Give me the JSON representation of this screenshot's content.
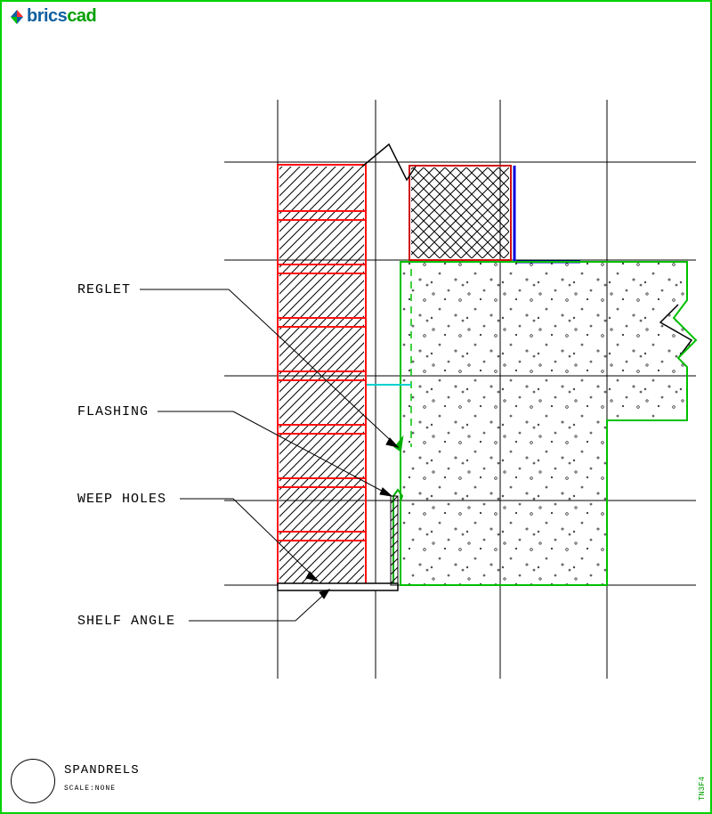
{
  "brand": {
    "part1": "brics",
    "part2": "cad"
  },
  "labels": {
    "reglet": "REGLET",
    "flashing": "FLASHING",
    "weep_holes": "WEEP HOLES",
    "shelf_angle": "SHELF ANGLE"
  },
  "titleblock": {
    "title": "SPANDRELS",
    "scale": "SCALE:NONE"
  },
  "side_code": "TN3F4",
  "chart_data": {
    "type": "diagram",
    "description": "Architectural section detail: Spandrel condition at concrete floor slab with brick veneer, showing shelf angle support, flashing with reglet termination, weep holes, cavity, and CMU/block backup above slab.",
    "callouts": [
      {
        "label": "REGLET",
        "points_to": "termination slot for flashing in backup/slab face"
      },
      {
        "label": "FLASHING",
        "points_to": "through-wall flashing over shelf angle, turned up at back"
      },
      {
        "label": "WEEP HOLES",
        "points_to": "open head joints in brick course immediately above shelf angle"
      },
      {
        "label": "SHELF ANGLE",
        "points_to": "steel angle bolted to slab edge supporting brick veneer"
      }
    ],
    "materials": [
      {
        "name": "brick veneer",
        "hatch": "diagonal",
        "color": "red"
      },
      {
        "name": "concrete slab / spandrel beam",
        "hatch": "stipple",
        "color": "green"
      },
      {
        "name": "CMU / block backup",
        "hatch": "crosshatch",
        "color": "black/red"
      },
      {
        "name": "air cavity",
        "hatch": "none"
      },
      {
        "name": "flashing",
        "hatch": "line",
        "color": "green"
      },
      {
        "name": "shelf angle",
        "hatch": "solid-ish",
        "color": "black"
      }
    ]
  }
}
